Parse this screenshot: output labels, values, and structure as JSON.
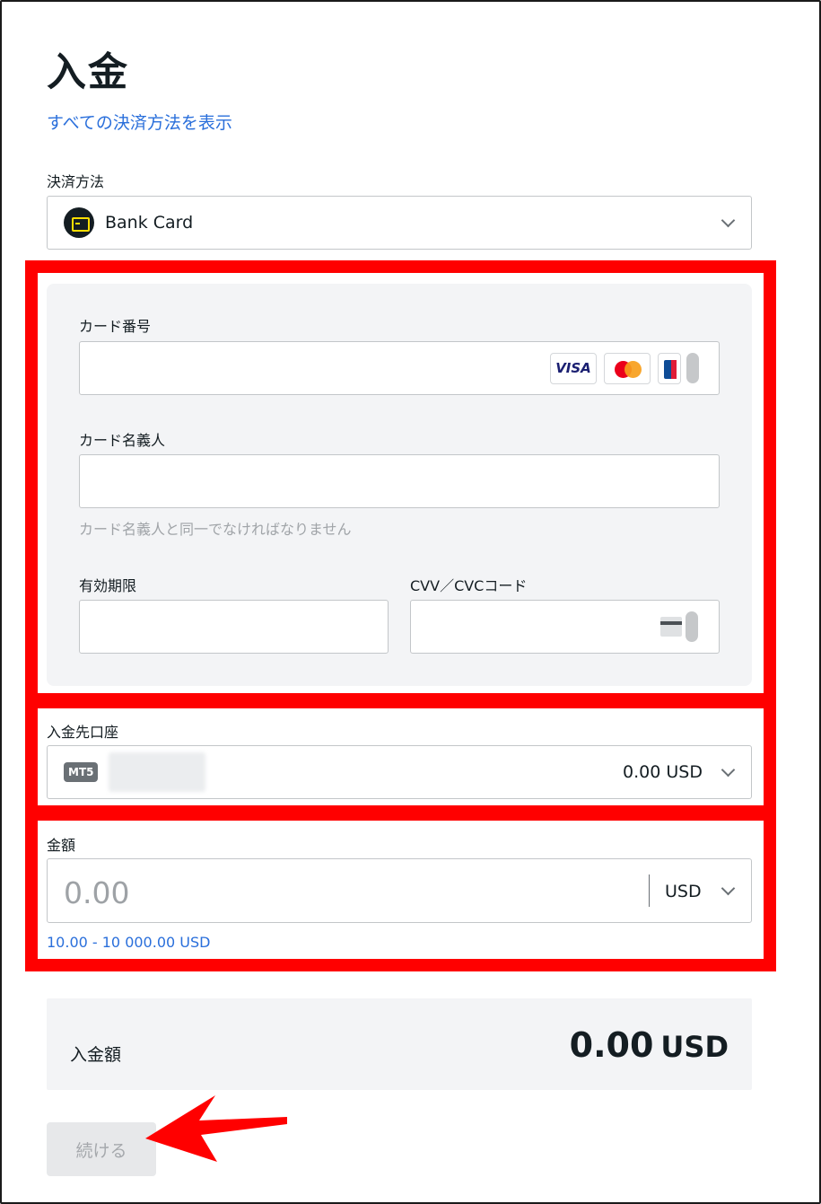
{
  "page": {
    "title": "入金",
    "all_methods_link": "すべての決済方法を表示"
  },
  "payment_method": {
    "label": "決済方法",
    "value": "Bank Card",
    "icon": "bank-card-icon"
  },
  "card_form": {
    "card_number_label": "カード番号",
    "card_brands": [
      "VISA",
      "mastercard-icon",
      "jcb-icon"
    ],
    "cardholder_label": "カード名義人",
    "cardholder_hint": "カード名義人と同一でなければなりません",
    "expiry_label": "有効期限",
    "cvv_label": "CVV／CVCコード"
  },
  "account": {
    "label": "入金先口座",
    "badge": "MT5",
    "balance": "0.00 USD"
  },
  "amount": {
    "label": "金額",
    "placeholder": "0.00",
    "currency": "USD",
    "range": "10.00 - 10 000.00 USD"
  },
  "summary": {
    "label": "入金額",
    "value": "0.00",
    "currency": "USD"
  },
  "continue_button": "続ける",
  "colors": {
    "highlight": "#ff0000",
    "link": "#2a6fdb",
    "panel": "#f3f4f6",
    "accent": "#ffde02"
  }
}
